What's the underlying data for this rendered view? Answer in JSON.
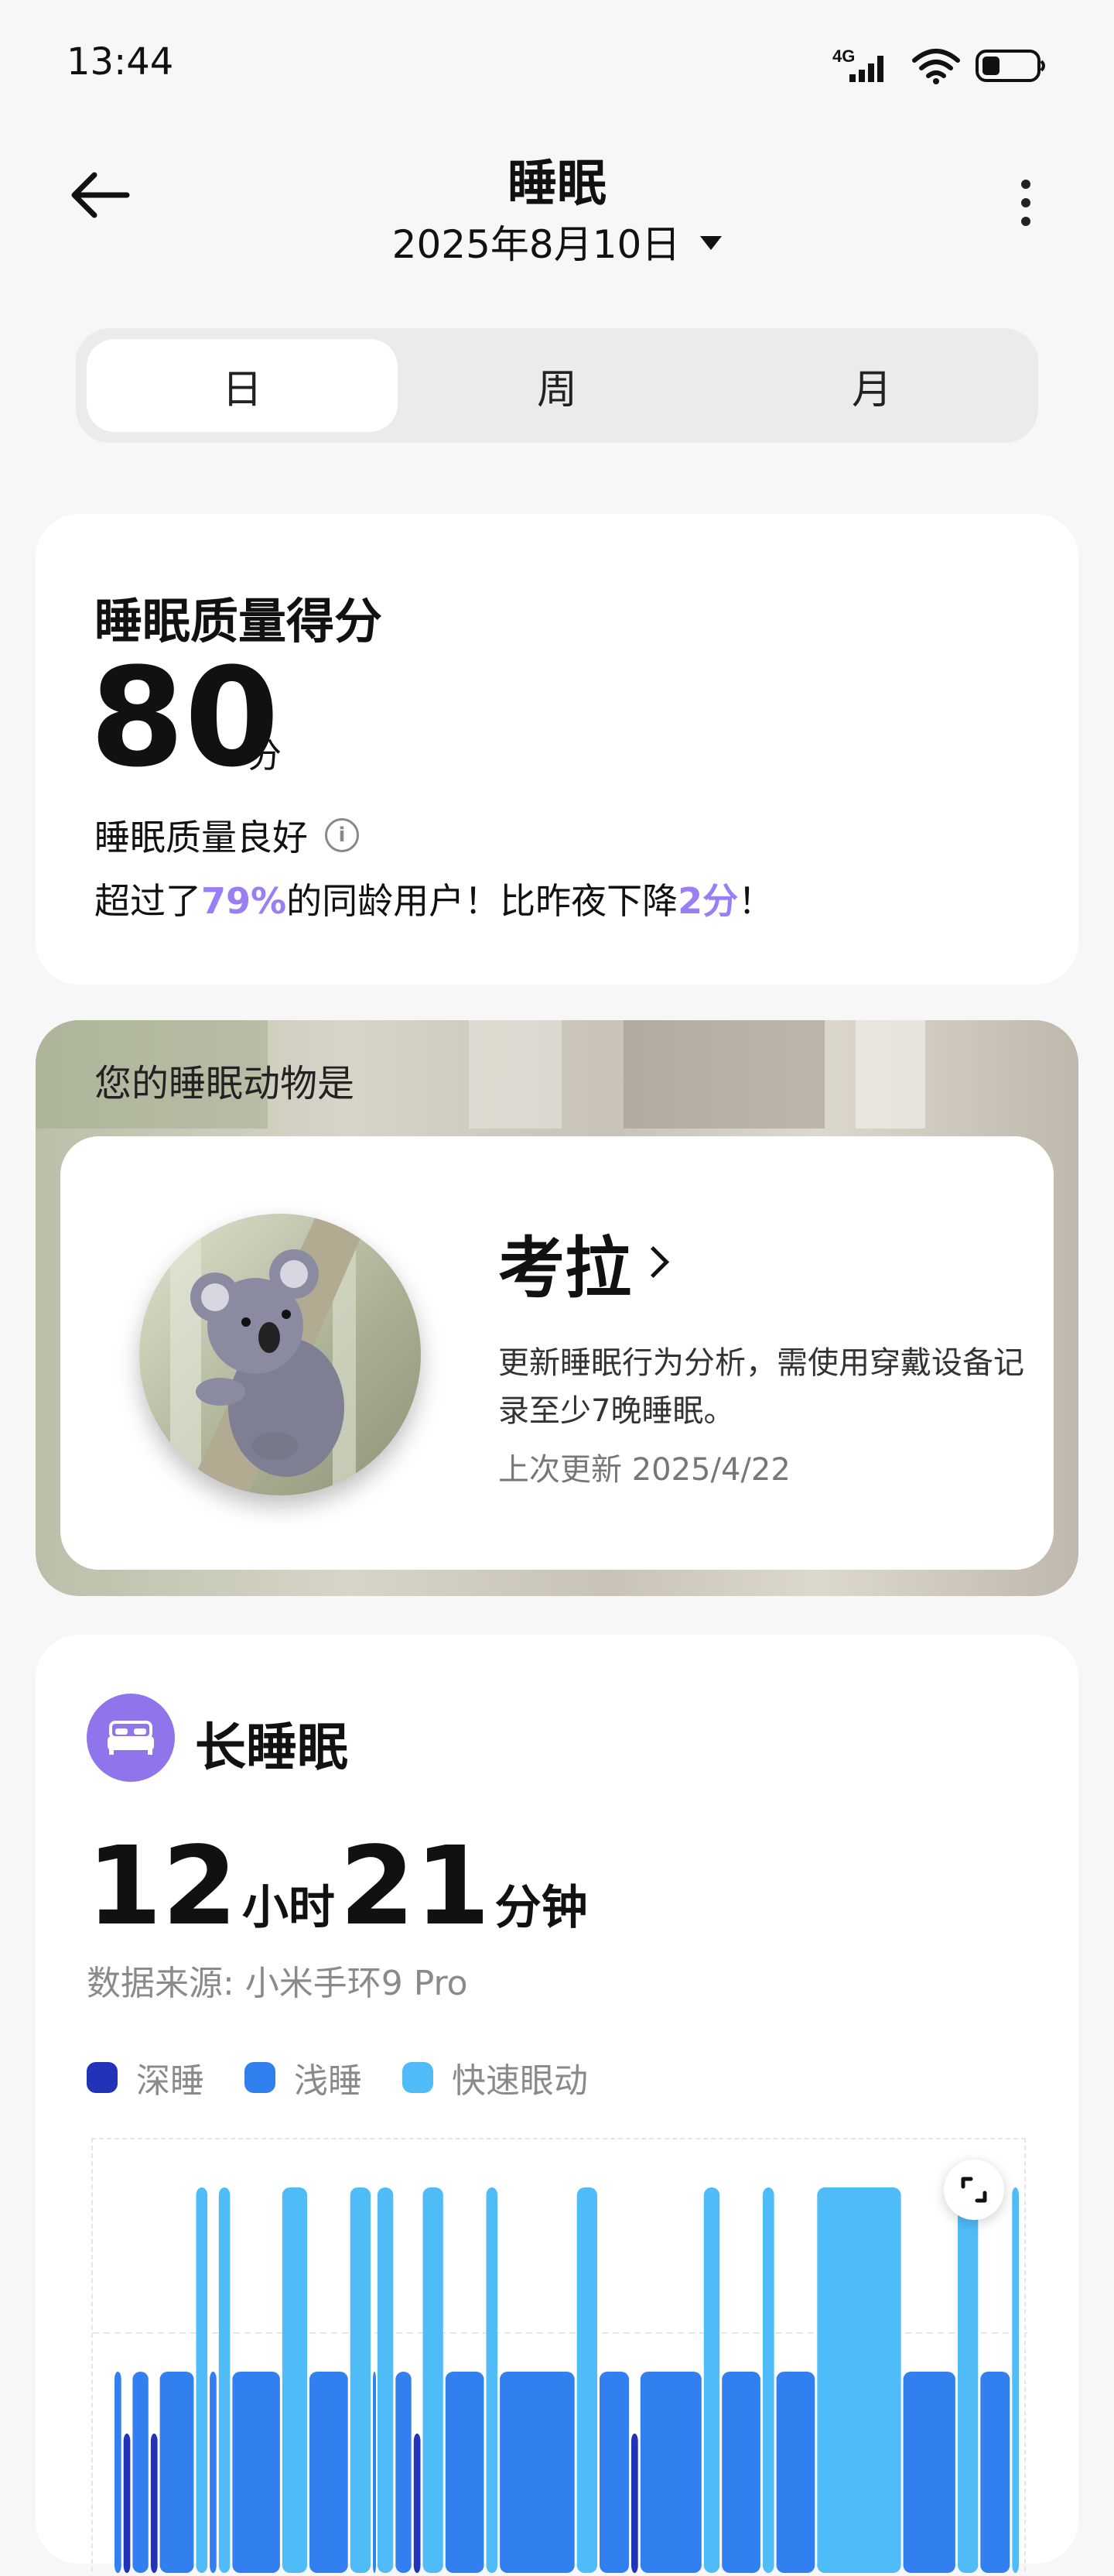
{
  "status": {
    "time": "13:44",
    "network": "4G"
  },
  "header": {
    "title": "睡眠",
    "date": "2025年8月10日"
  },
  "tabs": [
    {
      "label": "日",
      "active": true
    },
    {
      "label": "周"
    },
    {
      "label": "月"
    }
  ],
  "score": {
    "title": "睡眠质量得分",
    "value": "80",
    "unit": "分",
    "level": "睡眠质量良好",
    "desc_prefix": "超过了",
    "desc_percent": "79%",
    "desc_mid": "的同龄用户！比昨夜下降",
    "desc_points": "2分",
    "desc_suffix": "！"
  },
  "animal": {
    "label": "您的睡眠动物是",
    "name": "考拉",
    "desc": "更新睡眠行为分析，需使用穿戴设备记录至少7晚睡眠。",
    "updated": "上次更新 2025/4/22"
  },
  "long_sleep": {
    "title": "长睡眠",
    "hours": "12",
    "hours_unit": "小时",
    "minutes": "21",
    "minutes_unit": "分钟",
    "source": "数据来源: 小米手环9 Pro",
    "legend": [
      {
        "label": "深睡",
        "color": "#2233b8"
      },
      {
        "label": "浅睡",
        "color": "#3280f0"
      },
      {
        "label": "快速眼动",
        "color": "#4fbcf8"
      }
    ]
  },
  "chart_data": {
    "type": "bar",
    "title": "",
    "segments": [
      [
        "light",
        0.0,
        0.01
      ],
      [
        "deep",
        0.01,
        0.02
      ],
      [
        "light",
        0.02,
        0.04
      ],
      [
        "deep",
        0.04,
        0.05
      ],
      [
        "light",
        0.05,
        0.09
      ],
      [
        "rem",
        0.09,
        0.105
      ],
      [
        "light",
        0.105,
        0.115
      ],
      [
        "rem",
        0.115,
        0.13
      ],
      [
        "light",
        0.13,
        0.185
      ],
      [
        "rem",
        0.185,
        0.215
      ],
      [
        "light",
        0.215,
        0.26
      ],
      [
        "rem",
        0.26,
        0.285
      ],
      [
        "light",
        0.285,
        0.29
      ],
      [
        "rem",
        0.29,
        0.31
      ],
      [
        "light",
        0.31,
        0.33
      ],
      [
        "deep",
        0.33,
        0.34
      ],
      [
        "rem",
        0.34,
        0.365
      ],
      [
        "light",
        0.365,
        0.41
      ],
      [
        "rem",
        0.41,
        0.425
      ],
      [
        "light",
        0.425,
        0.51
      ],
      [
        "rem",
        0.51,
        0.535
      ],
      [
        "light",
        0.535,
        0.57
      ],
      [
        "deep",
        0.57,
        0.58
      ],
      [
        "light",
        0.58,
        0.65
      ],
      [
        "rem",
        0.65,
        0.67
      ],
      [
        "light",
        0.67,
        0.715
      ],
      [
        "rem",
        0.715,
        0.73
      ],
      [
        "light",
        0.73,
        0.775
      ],
      [
        "rem",
        0.775,
        0.87
      ],
      [
        "light",
        0.87,
        0.93
      ],
      [
        "rem",
        0.93,
        0.955
      ],
      [
        "light",
        0.955,
        0.99
      ],
      [
        "rem",
        0.99,
        1.0
      ]
    ]
  }
}
